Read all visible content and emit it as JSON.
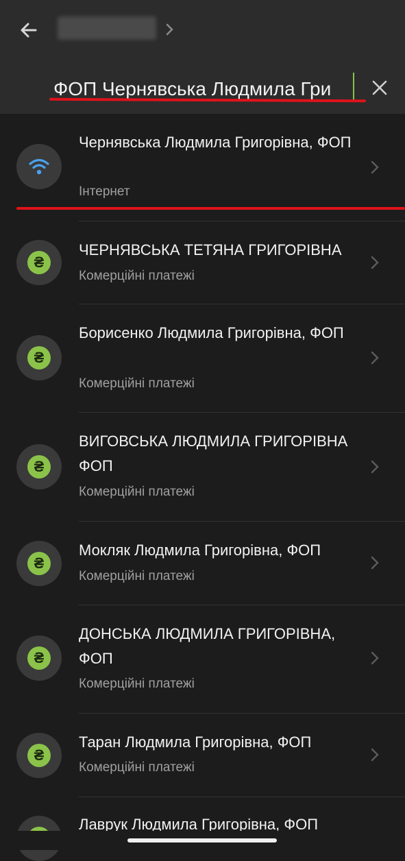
{
  "header": {
    "back_icon": "arrow-left-icon",
    "breadcrumb_icon": "chevron-right-icon",
    "search_value": "ФОП Чернявська Людмила Гри",
    "clear_icon": "close-icon"
  },
  "results": [
    {
      "title": "Чернявська Людмила Григорівна, ФОП",
      "category": "Інтернет",
      "icon": "wifi-icon"
    },
    {
      "title": "ЧЕРНЯВСЬКА ТЕТЯНА ГРИГОРІВНА",
      "category": "Комерційні платежі",
      "icon": "hryvnia-icon"
    },
    {
      "title": "Борисенко Людмила Григорівна, ФОП",
      "category": "Комерційні платежі",
      "icon": "hryvnia-icon"
    },
    {
      "title": "ВИГОВСЬКА ЛЮДМИЛА ГРИГОРІВНА ФОП",
      "category": "Комерційні платежі",
      "icon": "hryvnia-icon"
    },
    {
      "title": "Мокляк Людмила Григорівна, ФОП",
      "category": "Комерційні платежі",
      "icon": "hryvnia-icon"
    },
    {
      "title": "ДОНСЬКА ЛЮДМИЛА ГРИГОРІВНА, ФОП",
      "category": "Комерційні платежі",
      "icon": "hryvnia-icon"
    },
    {
      "title": "Таран Людмила Григорівна, ФОП",
      "category": "Комерційні платежі",
      "icon": "hryvnia-icon"
    },
    {
      "title": "Лаврук Людмила Григорівна, ФОП",
      "category": "",
      "icon": "hryvnia-icon"
    }
  ],
  "coin_symbol": "₴",
  "colors": {
    "accent": "#8bc34a",
    "wifi": "#4aa3f0",
    "annotation": "#e0121b"
  }
}
